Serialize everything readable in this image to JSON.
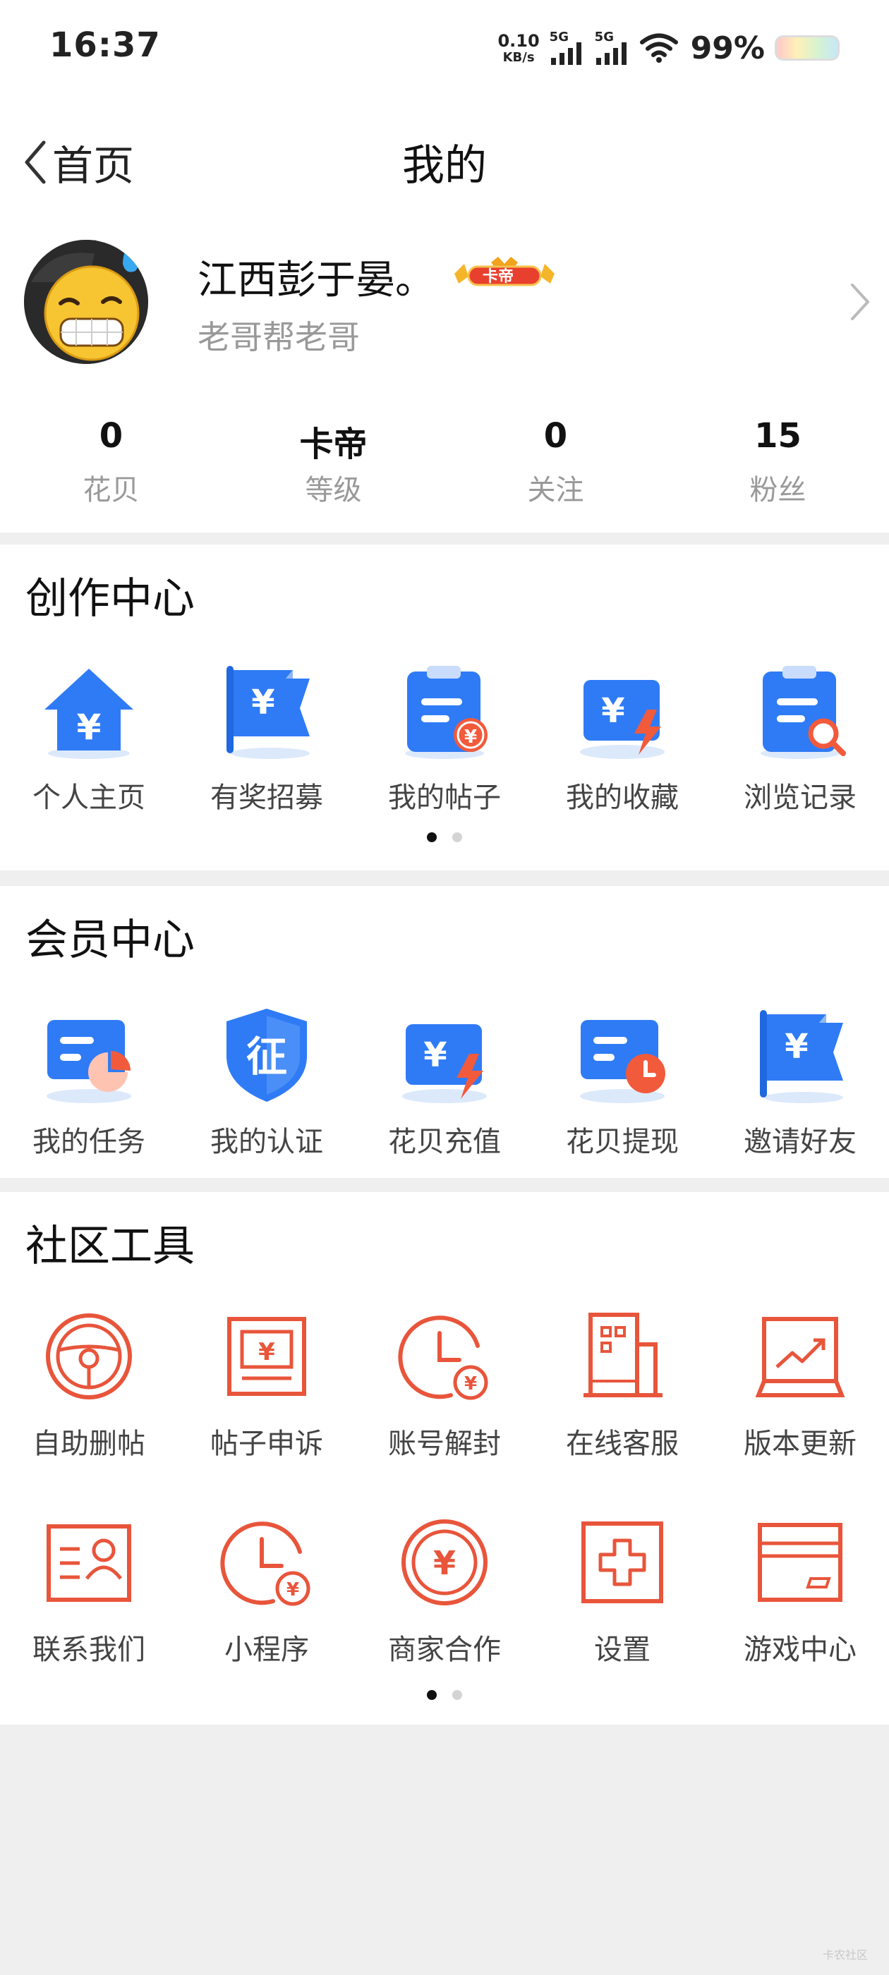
{
  "status_bar": {
    "time": "16:37",
    "net_speed_value": "0.10",
    "net_speed_unit": "KB/s",
    "sim1_label": "5G",
    "sim2_label": "5G",
    "battery_percent": "99%"
  },
  "header": {
    "back_label": "首页",
    "title": "我的"
  },
  "profile": {
    "username": "江西彭于晏。",
    "vip_badge": "卡帝",
    "signature": "老哥帮老哥",
    "stats": [
      {
        "value": "0",
        "label": "花贝"
      },
      {
        "value": "卡帝",
        "label": "等级"
      },
      {
        "value": "0",
        "label": "关注"
      },
      {
        "value": "15",
        "label": "粉丝"
      }
    ]
  },
  "creation_center": {
    "title": "创作中心",
    "items": [
      {
        "label": "个人主页",
        "icon": "house-yuan-icon"
      },
      {
        "label": "有奖招募",
        "icon": "flag-yuan-icon"
      },
      {
        "label": "我的帖子",
        "icon": "clipboard-yuan-icon"
      },
      {
        "label": "我的收藏",
        "icon": "card-lightning-icon"
      },
      {
        "label": "浏览记录",
        "icon": "clipboard-search-icon"
      }
    ]
  },
  "member_center": {
    "title": "会员中心",
    "items": [
      {
        "label": "我的任务",
        "icon": "card-pie-icon"
      },
      {
        "label": "我的认证",
        "icon": "shield-verify-icon"
      },
      {
        "label": "花贝充值",
        "icon": "card-lightning-icon"
      },
      {
        "label": "花贝提现",
        "icon": "card-clock-icon"
      },
      {
        "label": "邀请好友",
        "icon": "flag-yuan-icon"
      }
    ]
  },
  "community_tools": {
    "title": "社区工具",
    "rows": [
      [
        {
          "label": "自助删帖",
          "icon": "steering-wheel-icon"
        },
        {
          "label": "帖子申诉",
          "icon": "banknote-icon"
        },
        {
          "label": "账号解封",
          "icon": "clock-yuan-icon"
        },
        {
          "label": "在线客服",
          "icon": "building-icon"
        },
        {
          "label": "版本更新",
          "icon": "chart-trend-icon"
        }
      ],
      [
        {
          "label": "联系我们",
          "icon": "contact-card-icon"
        },
        {
          "label": "小程序",
          "icon": "clock-yuan-icon"
        },
        {
          "label": "商家合作",
          "icon": "coin-yuan-icon"
        },
        {
          "label": "设置",
          "icon": "plus-box-icon"
        },
        {
          "label": "游戏中心",
          "icon": "card-icon"
        }
      ]
    ]
  },
  "watermark": "卡农社区",
  "colors": {
    "blue": "#2f7bf5",
    "light_blue": "#dce9fb",
    "orange": "#f25a3c",
    "red_outline": "#e8553b"
  }
}
